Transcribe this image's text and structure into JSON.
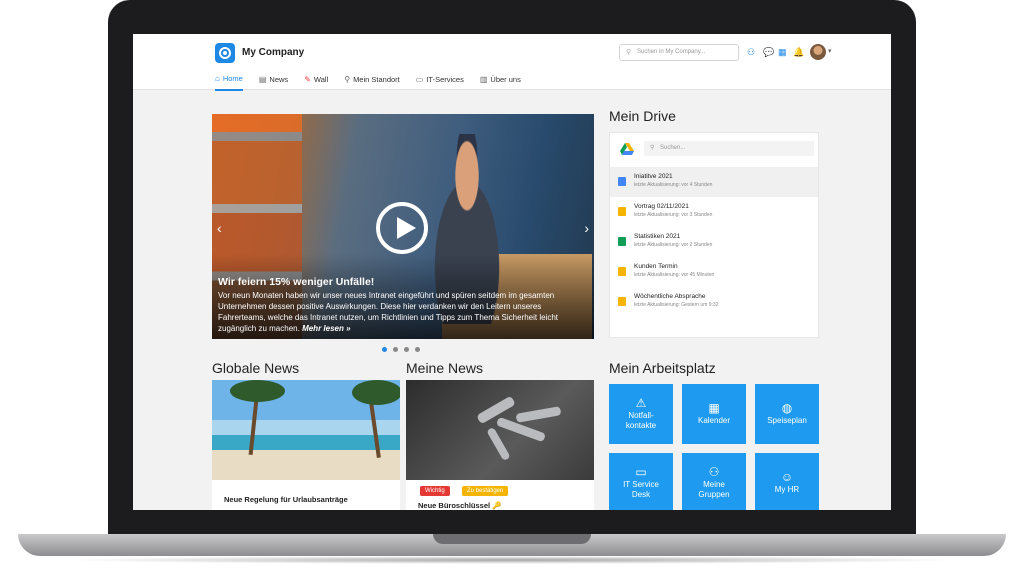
{
  "header": {
    "company": "My Company",
    "search_placeholder": "Suchen in My Company..."
  },
  "nav": [
    {
      "label": "Home",
      "icon": "home-icon",
      "active": true
    },
    {
      "label": "News",
      "icon": "news-icon"
    },
    {
      "label": "Wall",
      "icon": "wall-icon"
    },
    {
      "label": "Mein Standort",
      "icon": "location-pin-icon"
    },
    {
      "label": "IT-Services",
      "icon": "monitor-icon"
    },
    {
      "label": "Über uns",
      "icon": "building-icon"
    }
  ],
  "hero": {
    "title": "Wir feiern 15% weniger Unfälle!",
    "text": "Vor neun Monaten haben wir unser neues Intranet eingeführt und spüren seitdem im gesamten Unternehmen dessen positive Auswirkungen. Diese hier verdanken wir den Leitern unseres Fahrerteams, welche das Intranet nutzen, um Richtlinien und Tipps zum Thema Sicherheit leicht zugänglich zu machen.",
    "read_more": "Mehr lesen »"
  },
  "drive": {
    "title": "Mein Drive",
    "search_placeholder": "Suchen...",
    "items": [
      {
        "name": "Iniatitve 2021",
        "meta": "letzte Aktualisierung: vor 4 Stunden",
        "type": "doc",
        "color": "#4285f4"
      },
      {
        "name": "Vortrag 02/11/2021",
        "meta": "letzte Aktualisierung: vor 3 Stunden",
        "type": "slides",
        "color": "#f4b400"
      },
      {
        "name": "Statistiken 2021",
        "meta": "letzte Aktualisierung: vor 2 Stunden",
        "type": "sheet",
        "color": "#0f9d58"
      },
      {
        "name": "Kunden Termin",
        "meta": "letzte Aktualisierung: vor 45 Minuten",
        "type": "slides",
        "color": "#f4b400"
      },
      {
        "name": "Wöchentliche Absprache",
        "meta": "letzte Aktualisierung: Gestern um 9:32",
        "type": "slides",
        "color": "#f4b400"
      }
    ]
  },
  "global_news": {
    "title": "Globale News",
    "card_title": "Neue Regelung für Urlaubsanträge"
  },
  "my_news": {
    "title": "Meine News",
    "badge_important": "Wichtig",
    "badge_confirm": "Zu bestätigen",
    "card_title": "Neue Büroschlüssel 🔑"
  },
  "workplace": {
    "title": "Mein Arbeitsplatz",
    "tiles": [
      {
        "label": "Notfall-\nkontakte",
        "icon": "warning-icon"
      },
      {
        "label": "Kalender",
        "icon": "calendar-icon"
      },
      {
        "label": "Speiseplan",
        "icon": "food-icon"
      },
      {
        "label": "IT Service\nDesk",
        "icon": "monitor-icon"
      },
      {
        "label": "Meine\nGruppen",
        "icon": "group-icon"
      },
      {
        "label": "My HR",
        "icon": "person-icon"
      }
    ]
  },
  "colors": {
    "accent": "#1e88e5",
    "tile": "#1e9bf0",
    "badge_red": "#e53935",
    "badge_yellow": "#f4b400"
  }
}
